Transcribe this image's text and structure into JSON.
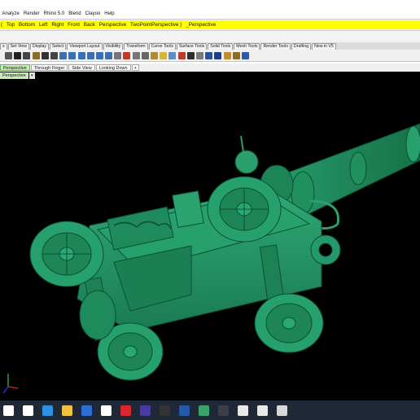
{
  "menu": [
    "Analyze",
    "Render",
    "Rhino 5.0",
    "Blend",
    "Clayoo",
    "Help"
  ],
  "command": {
    "prefix": "(",
    "options": [
      "Top",
      "Bottom",
      "Left",
      "Right",
      "Front",
      "Back",
      "Perspective",
      "TwoPointPerspective )"
    ],
    "suffix": "_Perspective"
  },
  "toolbar_tabs": [
    "s",
    "Set View",
    "Display",
    "Select",
    "Viewport Layout",
    "Visibility",
    "Transform",
    "Curve Tools",
    "Surface Tools",
    "Solid Tools",
    "Mesh Tools",
    "Render Tools",
    "Drafting",
    "New in V5"
  ],
  "toolbar_icons": [
    {
      "name": "new-file-icon",
      "color": "#555555"
    },
    {
      "name": "cut-icon",
      "color": "#222222"
    },
    {
      "name": "copy-icon",
      "color": "#444444"
    },
    {
      "name": "paste-icon",
      "color": "#8a6d2c"
    },
    {
      "name": "undo-icon",
      "color": "#333333"
    },
    {
      "name": "pan-icon",
      "color": "#444444"
    },
    {
      "name": "rotate-view-icon",
      "color": "#3a6fb0"
    },
    {
      "name": "zoom-icon",
      "color": "#3a6fb0"
    },
    {
      "name": "zoom-window-icon",
      "color": "#3a6fb0"
    },
    {
      "name": "zoom-extents-icon",
      "color": "#3a6fb0"
    },
    {
      "name": "zoom-selected-icon",
      "color": "#3a6fb0"
    },
    {
      "name": "undo-view-icon",
      "color": "#3a6fb0"
    },
    {
      "name": "four-viewports-icon",
      "color": "#777777"
    },
    {
      "name": "cplane-icon",
      "color": "#c0392b"
    },
    {
      "name": "grid-snap-icon",
      "color": "#777777"
    },
    {
      "name": "select-icon",
      "color": "#666666"
    },
    {
      "name": "lock-icon",
      "color": "#b08b2d"
    },
    {
      "name": "light-icon",
      "color": "#d4b43c"
    },
    {
      "name": "layers-icon",
      "color": "#5b8bc9"
    },
    {
      "name": "material-icon",
      "color": "#c0392b"
    },
    {
      "name": "shaded-icon",
      "color": "#2e2e2e"
    },
    {
      "name": "rendered-icon",
      "color": "#7a7a7a"
    },
    {
      "name": "ghosted-icon",
      "color": "#2b4f99"
    },
    {
      "name": "render-icon",
      "color": "#1c3f8a"
    },
    {
      "name": "settings-icon",
      "color": "#c48d2a"
    },
    {
      "name": "options-icon",
      "color": "#8a6d2c"
    },
    {
      "name": "help-icon",
      "color": "#2a5bb0"
    }
  ],
  "viewport_tabs": [
    "Perspective",
    "Through Finger",
    "Side View",
    "Looking Down",
    "+"
  ],
  "viewport_label": "Perspective",
  "viewport_dropdown": "▾",
  "taskbar_icons": [
    {
      "name": "windows-start-icon",
      "color": "#ffffff"
    },
    {
      "name": "search-icon",
      "color": "#ffffff"
    },
    {
      "name": "edge-browser-icon",
      "color": "#2f8fe0"
    },
    {
      "name": "file-explorer-icon",
      "color": "#f0c040"
    },
    {
      "name": "mail-icon",
      "color": "#2b6ed6"
    },
    {
      "name": "store-icon",
      "color": "#ffffff"
    },
    {
      "name": "opera-icon",
      "color": "#d9262f"
    },
    {
      "name": "app-purple-icon",
      "color": "#4a3aa0"
    },
    {
      "name": "app-dark-icon",
      "color": "#333333"
    },
    {
      "name": "blender-icon",
      "color": "#2559a8"
    },
    {
      "name": "rhino-active-icon",
      "color": "#3aa36c"
    },
    {
      "name": "app-round-icon",
      "color": "#3a3f49"
    },
    {
      "name": "calculator-icon",
      "color": "#e8e8e8"
    },
    {
      "name": "file-icon",
      "color": "#e8e8e8"
    },
    {
      "name": "extra-app-icon",
      "color": "#d9d9d9"
    }
  ],
  "colors": {
    "model": "#1f8a5f",
    "model_dark": "#0f5a3c",
    "command_bg": "#ffff00",
    "active_tab": "#cbe9bc"
  }
}
